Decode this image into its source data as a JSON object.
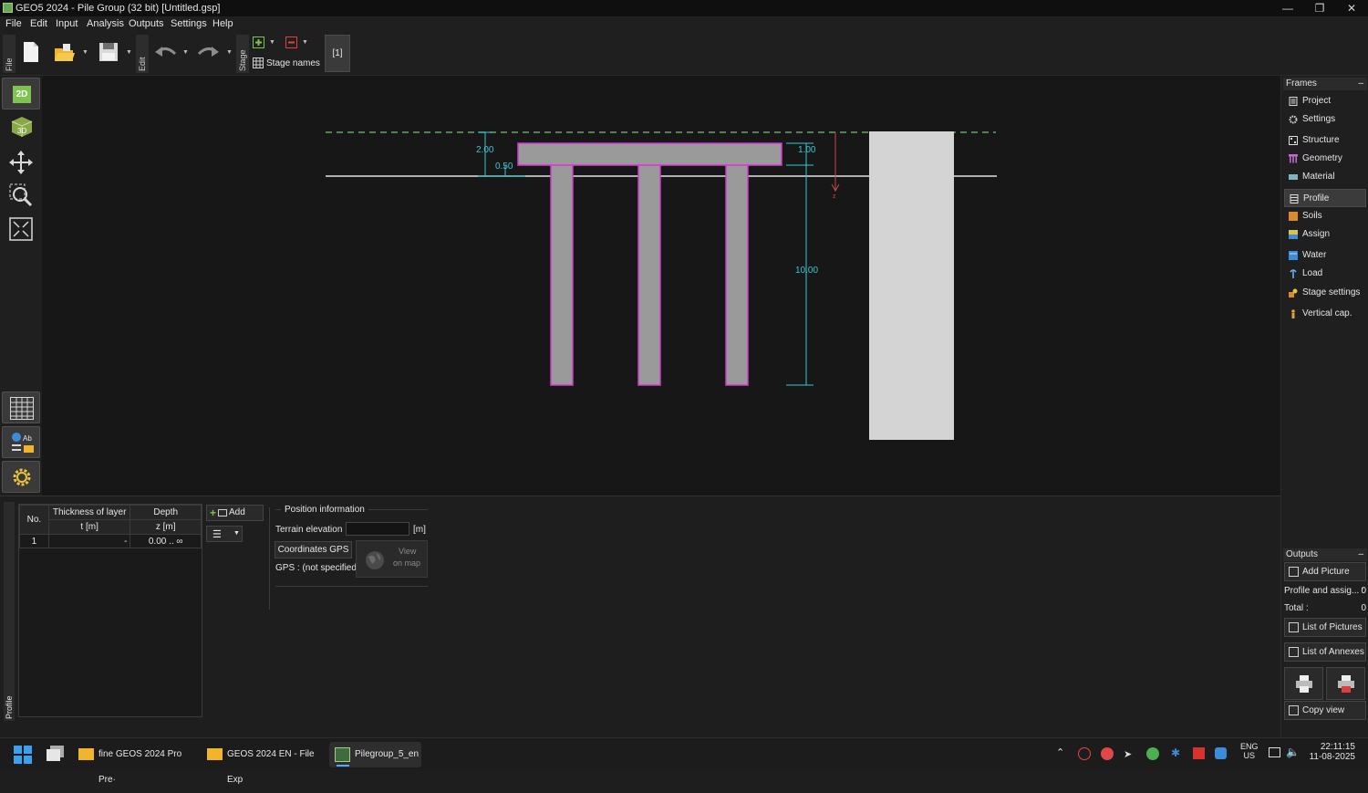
{
  "window": {
    "title": "GEO5 2024 - Pile Group (32 bit) [Untitled.gsp]",
    "controls": [
      "minimize",
      "restore",
      "close"
    ]
  },
  "menu": [
    "File",
    "Edit",
    "Input",
    "Analysis",
    "Outputs",
    "Settings",
    "Help"
  ],
  "toolbar": {
    "file_group": "File",
    "edit_group": "Edit",
    "stage_group": "Stage",
    "stage_names_label": "Stage names",
    "stage_button": "[1]"
  },
  "left_tools": {
    "mode_2d": "2D",
    "mode_3d": "3D"
  },
  "canvas": {
    "dimensions": {
      "cap_thickness": "2.00",
      "offset_left": "0.50",
      "offset_right": "1.00",
      "pile_length": "10.00"
    }
  },
  "frames": {
    "header": "Frames",
    "items": [
      {
        "label": "Project",
        "icon": "document-icon"
      },
      {
        "label": "Settings",
        "icon": "gear-icon"
      },
      {
        "label": "Structure",
        "icon": "structure-icon"
      },
      {
        "label": "Geometry",
        "icon": "geometry-icon"
      },
      {
        "label": "Material",
        "icon": "material-icon"
      },
      {
        "label": "Profile",
        "icon": "profile-icon"
      },
      {
        "label": "Soils",
        "icon": "soils-icon"
      },
      {
        "label": "Assign",
        "icon": "assign-icon"
      },
      {
        "label": "Water",
        "icon": "water-icon"
      },
      {
        "label": "Load",
        "icon": "load-icon"
      },
      {
        "label": "Stage settings",
        "icon": "stage-settings-icon"
      },
      {
        "label": "Vertical cap.",
        "icon": "vertical-cap-icon"
      }
    ],
    "active": "Profile"
  },
  "outputs": {
    "header": "Outputs",
    "add_picture": "Add Picture",
    "profile_label": "Profile and assig... :",
    "profile_count": "0",
    "total_label": "Total :",
    "total_count": "0",
    "list_pictures": "List of Pictures",
    "list_annexes": "List of Annexes",
    "copy_view": "Copy view"
  },
  "profile_panel": {
    "tab_label": "Profile",
    "columns": [
      {
        "title": "No.",
        "unit": ""
      },
      {
        "title": "Thickness of layer",
        "unit": "t [m]"
      },
      {
        "title": "Depth",
        "unit": "z [m]"
      }
    ],
    "rows": [
      {
        "no": "1",
        "thickness": "-",
        "depth": "0.00 .. ∞"
      }
    ],
    "add_button": "Add"
  },
  "position_info": {
    "title": "Position information",
    "terrain_label": "Terrain elevation :",
    "terrain_value": "",
    "terrain_unit": "[m]",
    "gps_button": "Coordinates GPS",
    "gps_status": "GPS : (not specified)",
    "view_on_map_1": "View",
    "view_on_map_2": "on map"
  },
  "taskbar": {
    "apps": [
      {
        "label": "fine GEOS 2024 Pro Pre·"
      },
      {
        "label": "GEOS 2024 EN - File Exp"
      },
      {
        "label": "Pilegroup_5_en"
      }
    ],
    "lang_top": "ENG",
    "lang_bottom": "US",
    "time": "22:11:15",
    "date": "11-08-2025"
  },
  "colors": {
    "pile_fill": "#9a9a9a",
    "pile_outline": "#d23ad2",
    "dimension": "#39c7d1",
    "terrain_dashed": "#6aa36a",
    "accent_green": "#7ec34f"
  }
}
